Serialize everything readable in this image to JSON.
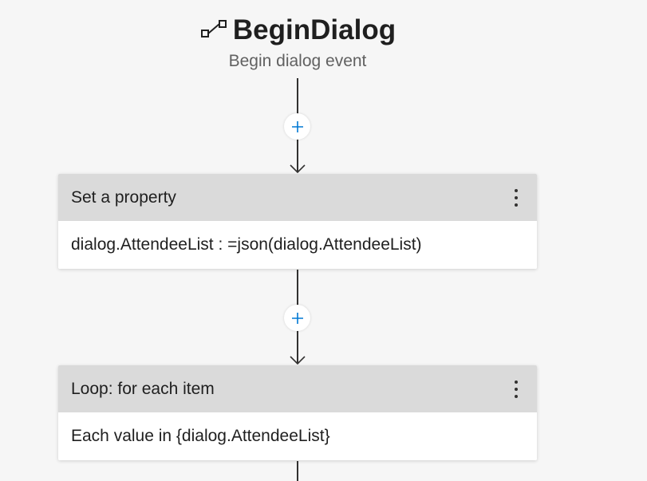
{
  "trigger": {
    "icon": "begin-dialog-icon",
    "title": "BeginDialog",
    "subtitle": "Begin dialog event"
  },
  "actions": [
    {
      "header": "Set a property",
      "body": "dialog.AttendeeList : =json(dialog.AttendeeList)",
      "menu_icon": "more-vertical-icon"
    },
    {
      "header": "Loop: for each item",
      "body": "Each value in {dialog.AttendeeList}",
      "menu_icon": "more-vertical-icon"
    }
  ],
  "add_button_icon": "plus-icon",
  "colors": {
    "background": "#f6f6f6",
    "card_header": "#dadada",
    "accent": "#0078d4",
    "line": "#323130"
  }
}
